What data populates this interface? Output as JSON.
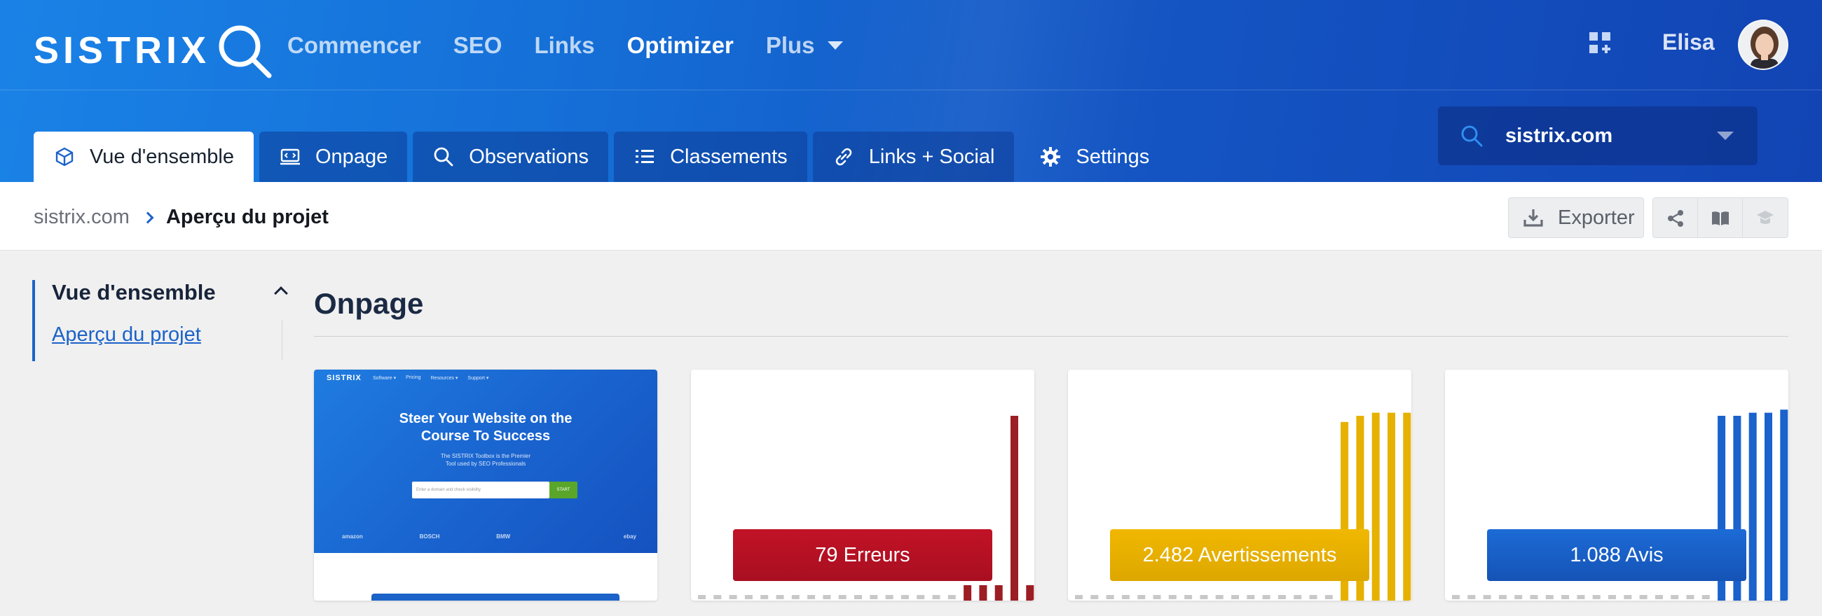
{
  "header": {
    "logo_text": "SISTRIX",
    "nav": [
      {
        "label": "Commencer",
        "active": false
      },
      {
        "label": "SEO",
        "active": false
      },
      {
        "label": "Links",
        "active": false
      },
      {
        "label": "Optimizer",
        "active": true
      },
      {
        "label": "Plus",
        "active": false,
        "has_dropdown": true
      }
    ],
    "apps_icon": "grid-plus-icon",
    "user_name": "Elisa"
  },
  "tabs": [
    {
      "label": "Vue d'ensemble",
      "icon": "cube-icon",
      "active": true
    },
    {
      "label": "Onpage",
      "icon": "monitor-code-icon",
      "active": false
    },
    {
      "label": "Observations",
      "icon": "search-icon",
      "active": false
    },
    {
      "label": "Classements",
      "icon": "list-icon",
      "active": false
    },
    {
      "label": "Links + Social",
      "icon": "link-icon",
      "active": false
    },
    {
      "label": "Settings",
      "icon": "gear-icon",
      "active": false
    }
  ],
  "domain_select": {
    "value": "sistrix.com",
    "icon": "search-icon"
  },
  "breadcrumb": {
    "root": "sistrix.com",
    "current": "Aperçu du projet"
  },
  "toolbar": {
    "export_label": "Exporter",
    "icons": [
      "share-icon",
      "book-icon",
      "graduation-cap-icon"
    ]
  },
  "sidebar": {
    "heading": "Vue d'ensemble",
    "items": [
      {
        "label": "Aperçu du projet",
        "active": true
      }
    ]
  },
  "main": {
    "section_title": "Onpage",
    "screenshot": {
      "logo": "SISTRIX",
      "nav": [
        "Software ▾",
        "Pricing",
        "Resources ▾",
        "Support ▾"
      ],
      "headline_1": "Steer Your Website on the",
      "headline_2": "Course To Success",
      "sub_1": "The SISTRIX Toolbox is the Premier",
      "sub_2": "Tool used by SEO Professionals",
      "input_placeholder": "Enter a domain and check visibility",
      "start_label": "START",
      "brands": [
        "amazon",
        "BOSCH",
        "BMW",
        "",
        "ebay"
      ]
    },
    "cards": [
      {
        "label": "79 Erreurs",
        "color": "#b01020",
        "bar_color": "#9d1d24"
      },
      {
        "label": "2.482 Avertissements",
        "color": "#e8b000",
        "bar_color": "#e6b100"
      },
      {
        "label": "1.088 Avis",
        "color": "#1b62c9",
        "bar_color": "#1a62cc"
      }
    ]
  },
  "chart_data": [
    {
      "type": "bar",
      "title": "",
      "series": [
        {
          "values": [
            0,
            0,
            0,
            0,
            0,
            0,
            0,
            0,
            0,
            0,
            0,
            0,
            0,
            0,
            0,
            0,
            0,
            5,
            5,
            5,
            60,
            5
          ]
        }
      ],
      "ylim": [
        0,
        65
      ]
    },
    {
      "type": "bar",
      "title": "",
      "series": [
        {
          "values": [
            0,
            0,
            0,
            0,
            0,
            0,
            0,
            0,
            0,
            0,
            0,
            0,
            0,
            0,
            0,
            0,
            0,
            58,
            60,
            61,
            61,
            61
          ]
        }
      ],
      "ylim": [
        0,
        65
      ]
    },
    {
      "type": "bar",
      "title": "",
      "series": [
        {
          "values": [
            0,
            0,
            0,
            0,
            0,
            0,
            0,
            0,
            0,
            0,
            0,
            0,
            0,
            0,
            0,
            0,
            0,
            60,
            60,
            61,
            61,
            62
          ]
        }
      ],
      "ylim": [
        0,
        65
      ]
    }
  ]
}
